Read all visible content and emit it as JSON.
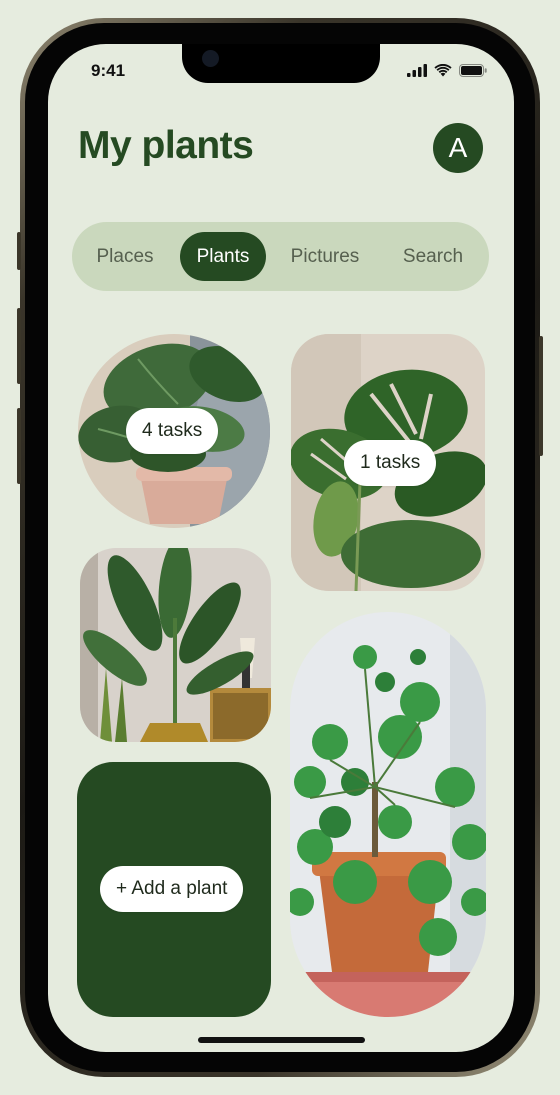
{
  "status_bar": {
    "time": "9:41"
  },
  "header": {
    "title": "My plants",
    "avatar_initial": "A"
  },
  "tabs": [
    {
      "label": "Places",
      "active": false
    },
    {
      "label": "Plants",
      "active": true
    },
    {
      "label": "Pictures",
      "active": false
    },
    {
      "label": "Search",
      "active": false
    }
  ],
  "plants": [
    {
      "name": "fiddle-leaf-fig",
      "badge": "4 tasks"
    },
    {
      "name": "monstera",
      "badge": "1 tasks"
    },
    {
      "name": "bird-of-paradise"
    },
    {
      "name": "pilea"
    }
  ],
  "add_card": {
    "label": "+ Add a plant"
  },
  "colors": {
    "accent": "#254a22",
    "background": "#e5ebde",
    "tab_track": "#cad8bd",
    "text_muted": "#56604f"
  }
}
